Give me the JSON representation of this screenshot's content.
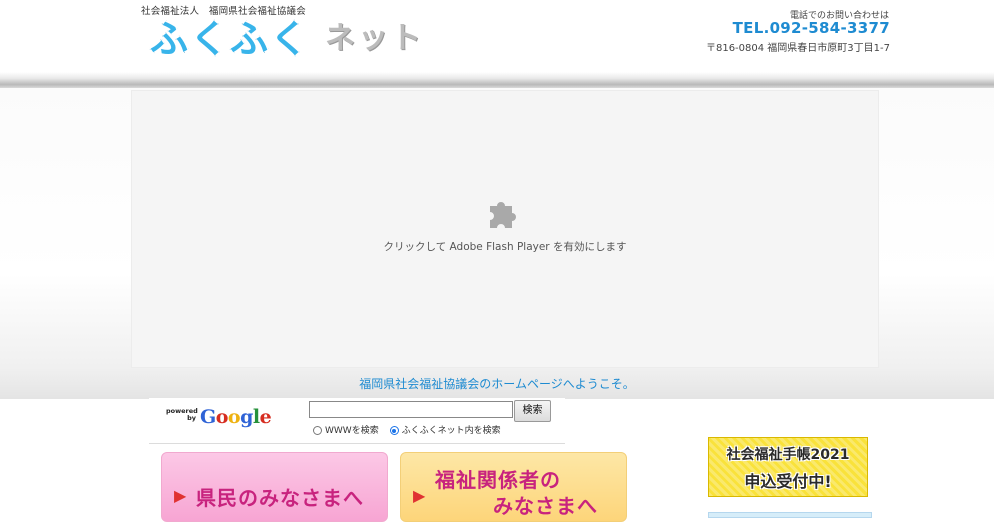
{
  "header": {
    "org_line": "社会福祉法人　福岡県社会福祉協議会",
    "logo_main": "ふくふく",
    "logo_sub": "ネット",
    "contact_caption": "電話でのお問い合わせは",
    "tel": "TEL.092-584-3377",
    "address": "〒816-0804 福岡県春日市原町3丁目1-7"
  },
  "flash_placeholder": {
    "icon": "puzzle-piece-icon",
    "message": "クリックして Adobe Flash Player を有効にします"
  },
  "welcome_text": "福岡県社会福祉協議会のホームページへようこそ。",
  "search": {
    "powered_by": "powered by",
    "brand": "Google",
    "input_value": "",
    "button_label": "検索",
    "options": [
      {
        "label": "WWWを検索",
        "checked": false
      },
      {
        "label": "ふくふくネット内を検索",
        "checked": true
      }
    ]
  },
  "nav": {
    "residents_label": "県民のみなさまへ",
    "professionals_line1": "福祉関係者の",
    "professionals_line2": "みなさまへ"
  },
  "side_banner": {
    "line1": "社会福祉手帳2021",
    "line2": "申込受付中!"
  },
  "colors": {
    "accent_blue": "#1e8bd1",
    "residents_pink": "#f7a5d3",
    "professionals_yellow": "#fdd57a",
    "banner_yellow": "#f9e23b"
  }
}
